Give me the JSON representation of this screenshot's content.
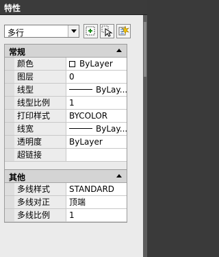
{
  "title": "特性",
  "selector": {
    "value": "多行"
  },
  "toolbar": {
    "toggle_pickadd_icon": "toggle-pickadd-icon",
    "select_objects_icon": "select-objects-icon",
    "quick_select_icon": "quick-select-icon"
  },
  "categories": [
    {
      "name": "常规",
      "rows": [
        {
          "label": "颜色",
          "value": "ByLayer",
          "marker": "swatch"
        },
        {
          "label": "图层",
          "value": "0"
        },
        {
          "label": "线型",
          "value": "ByLay...",
          "marker": "line"
        },
        {
          "label": "线型比例",
          "value": "1"
        },
        {
          "label": "打印样式",
          "value": "BYCOLOR"
        },
        {
          "label": "线宽",
          "value": "ByLay...",
          "marker": "line"
        },
        {
          "label": "透明度",
          "value": "ByLayer"
        },
        {
          "label": "超链接",
          "value": ""
        }
      ]
    },
    {
      "name": "其他",
      "rows": [
        {
          "label": "多线样式",
          "value": "STANDARD"
        },
        {
          "label": "多线对正",
          "value": "顶端"
        },
        {
          "label": "多线比例",
          "value": "1"
        }
      ]
    }
  ]
}
